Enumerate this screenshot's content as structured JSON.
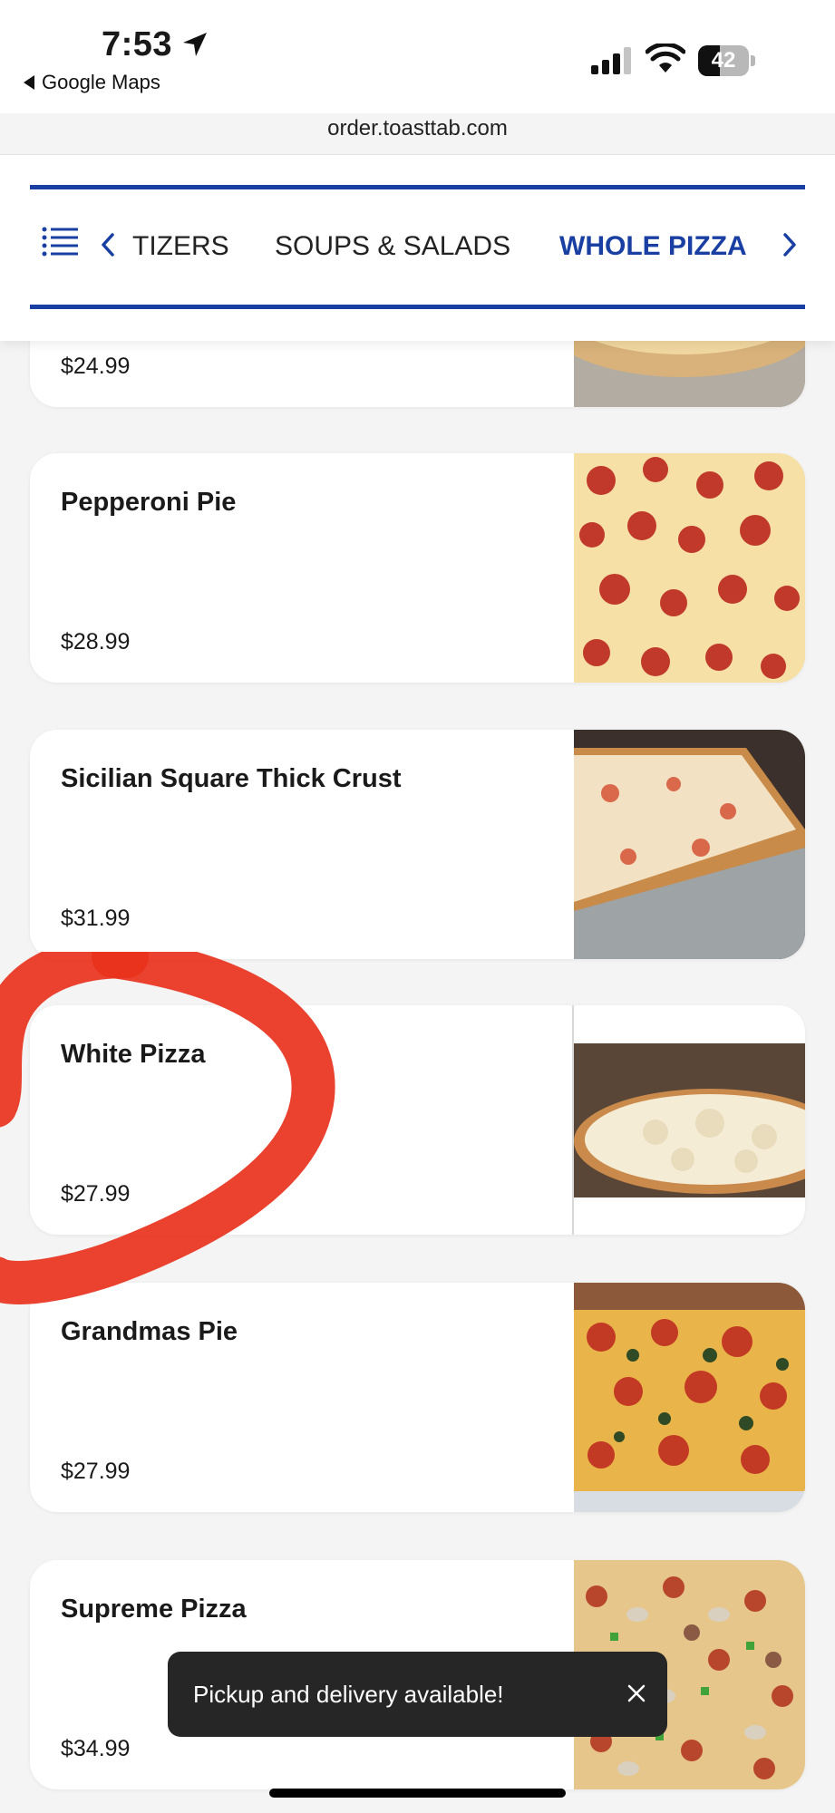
{
  "status_bar": {
    "time": "7:53",
    "back_app": "Google Maps",
    "battery": "42",
    "battery_level": 0.42
  },
  "browser": {
    "url": "order.toasttab.com"
  },
  "nav": {
    "tabs": [
      "TIZERS",
      "SOUPS & SALADS",
      "WHOLE PIZZA"
    ],
    "active_tab": "WHOLE PIZZA"
  },
  "menu_items": [
    {
      "name": "",
      "price": "$24.99"
    },
    {
      "name": "Pepperoni Pie",
      "price": "$28.99"
    },
    {
      "name": "Sicilian Square Thick Crust",
      "price": "$31.99"
    },
    {
      "name": "White Pizza",
      "price": "$27.99"
    },
    {
      "name": "Grandmas Pie",
      "price": "$27.99"
    },
    {
      "name": "Supreme Pizza",
      "price": "$34.99"
    }
  ],
  "toast": {
    "message": "Pickup and delivery available!"
  },
  "colors": {
    "accent": "#1a3fa3",
    "annotation": "#e8321c",
    "toast_bg": "#262626"
  },
  "icons": {
    "menu": "list-icon",
    "prev": "chevron-left-icon",
    "next": "chevron-right-icon",
    "close": "close-icon",
    "location": "location-arrow-icon"
  }
}
